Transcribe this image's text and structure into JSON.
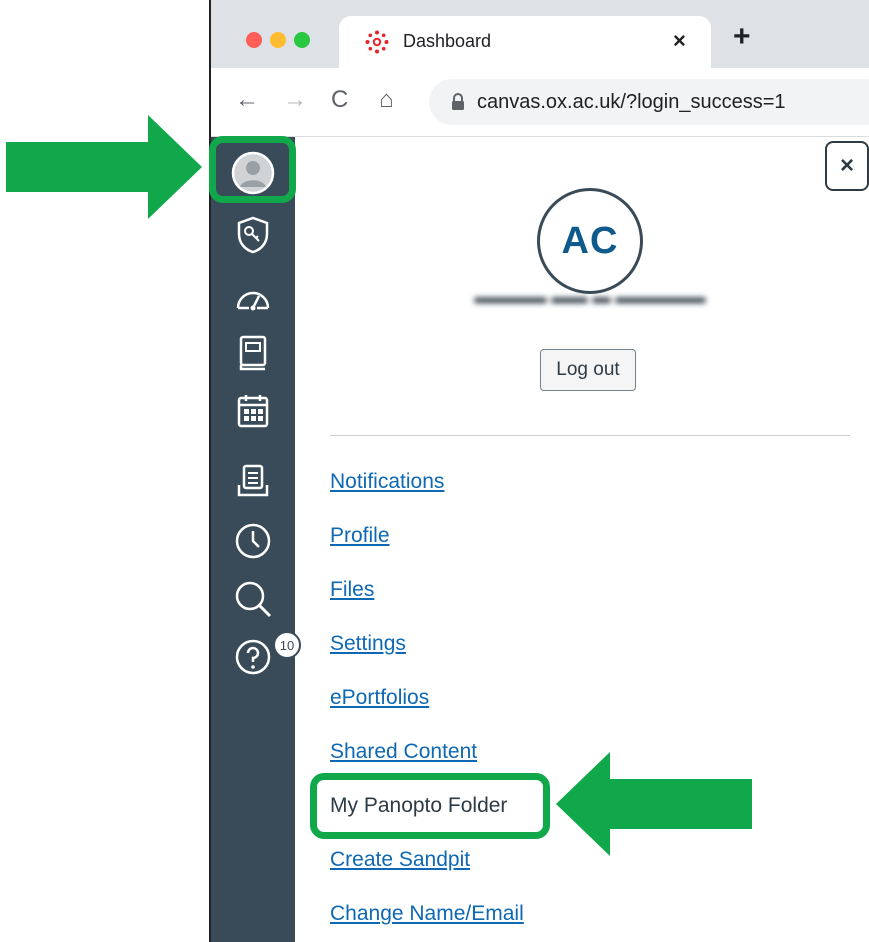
{
  "browser": {
    "tab_title": "Dashboard",
    "tab_close": "×",
    "new_tab": "+",
    "url": "canvas.ox.ac.uk/?login_success=1",
    "nav": {
      "back": "←",
      "forward": "→",
      "reload": "C",
      "home": "⌂"
    }
  },
  "sidebar": {
    "icons": [
      "avatar-icon",
      "admin-shield-icon",
      "dashboard-icon",
      "courses-icon",
      "calendar-icon",
      "inbox-icon",
      "history-icon",
      "search-icon",
      "help-icon"
    ],
    "help_badge": "10"
  },
  "tray": {
    "close_label": "×",
    "initials": "AC",
    "user_name": "▬▬▬▬ ▬▬ ▬ ▬▬▬▬▬",
    "logout_label": "Log out",
    "menu": [
      {
        "label": "Notifications"
      },
      {
        "label": "Profile"
      },
      {
        "label": "Files"
      },
      {
        "label": "Settings"
      },
      {
        "label": "ePortfolios"
      },
      {
        "label": "Shared Content"
      },
      {
        "label": "My Panopto Folder"
      },
      {
        "label": "Create Sandpit"
      },
      {
        "label": "Change Name/Email"
      }
    ]
  },
  "colors": {
    "highlight": "#10a84a",
    "sidebar": "#394b58",
    "link": "#0e68b3"
  }
}
